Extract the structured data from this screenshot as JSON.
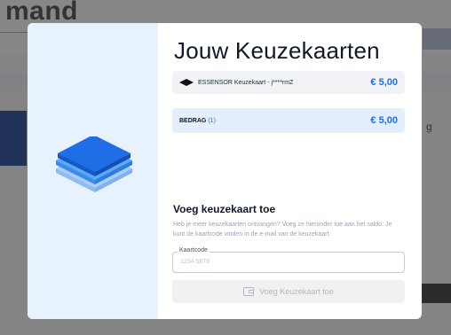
{
  "background": {
    "logo_text": "mand",
    "right_text": "g"
  },
  "modal": {
    "title": "Jouw Keuzekaarten",
    "card": {
      "icon": "card-icon",
      "name": "ESSENSOR Keuzekaart - j****rmZ",
      "amount": "€ 5,00"
    },
    "total": {
      "label": "BEDRAG",
      "count": "(1)",
      "amount": "€ 5,00"
    },
    "add_section": {
      "heading": "Voeg keuzekaart toe",
      "help_text": "Heb je meer keuzekaarten ontvangen? Voeg ze hieronder toe aan het saldo. Je kunt de kaartcode vinden in de e-mail van de keuzekaart.",
      "field_label": "Kaartcode",
      "field_placeholder": "1234 5678",
      "field_value": "",
      "button_label": "Voeg Keuzekaart toe",
      "button_icon": "wallet-icon"
    }
  },
  "colors": {
    "accent": "#1d6fe0",
    "left_panel": "#e8f1fe"
  }
}
